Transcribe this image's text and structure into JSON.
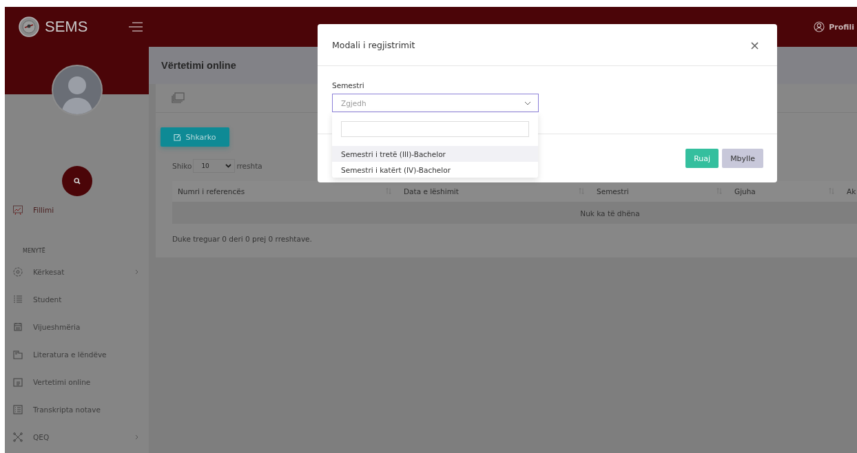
{
  "header": {
    "logo_text": "SEMS",
    "profile": "Profili"
  },
  "sidebar": {
    "home": {
      "label": "Fillimi"
    },
    "section_title": "MENYTË",
    "items": [
      {
        "label": "Kërkesat",
        "expandable": true
      },
      {
        "label": "Student",
        "expandable": false
      },
      {
        "label": "Vijueshmëria",
        "expandable": false
      },
      {
        "label": "Literatura e lëndëve",
        "expandable": false
      },
      {
        "label": "Vertetimi online",
        "expandable": false
      },
      {
        "label": "Transkripta notave",
        "expandable": false
      },
      {
        "label": "QEQ",
        "expandable": true
      }
    ]
  },
  "page": {
    "title": "Vërtetimi online",
    "download_button": "Shkarko",
    "length": {
      "prefix": "Shiko",
      "value": "10",
      "suffix": "rreshta"
    },
    "table": {
      "columns": [
        "Numri i referencës",
        "Data e lëshimit",
        "Semestri",
        "Gjuha",
        "Ak"
      ],
      "empty_message": "Nuk ka të dhëna"
    },
    "info": "Duke treguar 0 deri 0 prej 0 rreshtave."
  },
  "modal": {
    "title": "Modali i regjistrimit",
    "close": "×",
    "field_label": "Semestri",
    "select": {
      "placeholder": "Zgjedh",
      "open": true,
      "options": [
        {
          "label": "Semestri i tretë (III)-Bachelor",
          "highlighted": true
        },
        {
          "label": "Semestri i katërt (IV)-Bachelor",
          "highlighted": false
        }
      ]
    },
    "buttons": [
      {
        "label": "Ruaj",
        "kind": "primary"
      },
      {
        "label": "Mbylle",
        "kind": "secondary"
      }
    ]
  }
}
